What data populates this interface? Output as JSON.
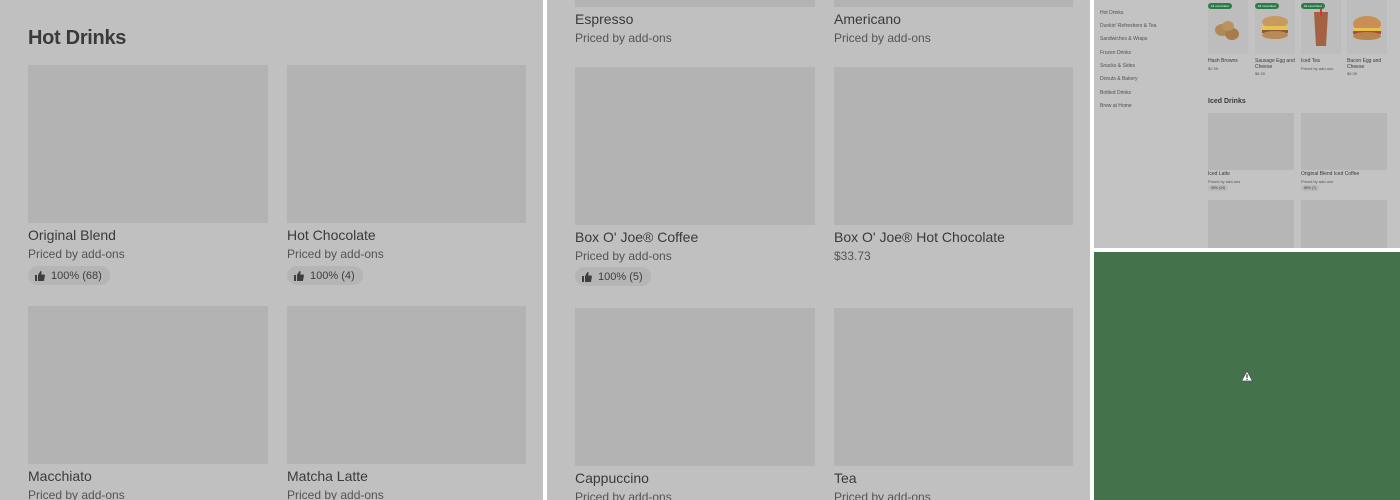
{
  "panel1": {
    "section_title": "Hot Drinks",
    "items": [
      {
        "name": "Original Blend",
        "price": "Priced by add-ons",
        "rating": "100% (68)"
      },
      {
        "name": "Hot Chocolate",
        "price": "Priced by add-ons",
        "rating": "100% (4)"
      },
      {
        "name": "Macchiato",
        "price": "Priced by add-ons"
      },
      {
        "name": "Matcha Latte",
        "price": "Priced by add-ons"
      }
    ]
  },
  "panel2": {
    "items": [
      {
        "name": "Espresso",
        "price": "Priced by add-ons"
      },
      {
        "name": "Americano",
        "price": "Priced by add-ons"
      },
      {
        "name": "Box O' Joe® Coffee",
        "price": "Priced by add-ons",
        "rating": "100% (5)"
      },
      {
        "name": "Box O' Joe® Hot Chocolate",
        "price": "$33.73"
      },
      {
        "name": "Cappuccino",
        "price": "Priced by add-ons"
      },
      {
        "name": "Tea",
        "price": "Priced by add-ons"
      }
    ]
  },
  "panel3": {
    "sidebar": [
      "Hot Drinks",
      "Dunkin' Refreshers & Tea",
      "Sandwiches & Wraps",
      "Frozen Drinks",
      "Snacks & Sides",
      "Donuts & Bakery",
      "Bottled Drinks",
      "Brew at Home"
    ],
    "top_items": [
      {
        "name": "Hash Browns",
        "price": "$2.99",
        "badge": "#1 most liked"
      },
      {
        "name": "Sausage Egg and Cheese",
        "price": "$6.39",
        "badge": "#2 most liked"
      },
      {
        "name": "Iced Tea",
        "price": "Priced by add-ons",
        "badge": "#3 most liked"
      },
      {
        "name": "Bacon Egg and Cheese",
        "price": "$6.39"
      }
    ],
    "section_title": "Iced Drinks",
    "iced_items": [
      {
        "name": "Iced Latte",
        "price": "Priced by add-ons",
        "rating": "95% (24)"
      },
      {
        "name": "Original Blend Iced Coffee",
        "price": "Priced by add-ons",
        "rating": "86% (7)"
      }
    ]
  },
  "panel4": {
    "icon": "warning-icon",
    "bg_color": "#44724b"
  }
}
